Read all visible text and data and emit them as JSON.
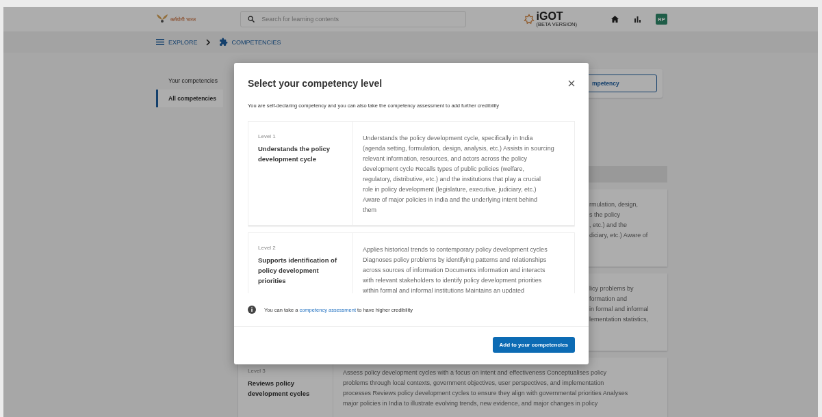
{
  "header": {
    "logo_text": "कर्मयोगी भारत",
    "search": {
      "placeholder": "Search for learning contents"
    },
    "brand": "iGOT",
    "brand_note": "(BETA VERSION)",
    "avatar": "RP"
  },
  "breadcrumb": [
    {
      "label": "EXPLORE",
      "kind": "menu"
    },
    {
      "label": "COMPETENCIES",
      "kind": "puzzle"
    }
  ],
  "sidebar": {
    "items": [
      {
        "label": "Your competencies",
        "selected": false
      },
      {
        "label": "All competencies",
        "selected": true
      }
    ]
  },
  "background": {
    "action_button": "mpetency",
    "cards": [
      {
        "lines": [
          "rmulation, design,",
          "s the policy",
          ", etc.) and the",
          "diciary, etc.) Aware of"
        ]
      },
      {
        "lines": [
          "licy problems by",
          "formation and",
          "in formal and informal",
          "lementation statistics,"
        ]
      },
      {
        "level": "Level 3",
        "title": "Reviews policy development cycles",
        "lines": [
          "Assess policy development cycles with a focus on intent and effectiveness Conceptualises policy",
          "problems through local contexts, government objectives, user perspectives, and implementation",
          "processes Reviews policy development cycles to ensure they align with governmental priorities Analyses",
          "major policies in India to illustrate evolving trends, new evidence, and major changes in policy"
        ]
      }
    ]
  },
  "dialog": {
    "title": "Select your competency level",
    "subtitle": "You are self-declaring competency and you can also take the competency assessment to add further credibility",
    "levels": [
      {
        "level": "Level 1",
        "title": "Understands the policy development cycle",
        "lines": [
          "Understands the policy development cycle, specifically in India",
          "(agenda setting, formulation, design, analysis, etc.) Assists in sourcing",
          "relevant information, resources, and actors across the policy",
          "development cycle Recalls types of public policies (welfare,",
          "regulatory, distributive, etc.) and the institutions that play a crucial",
          "role in policy development (legislature, executive, judiciary, etc.)",
          "Aware of major policies in India and the underlying intent behind",
          "them"
        ]
      },
      {
        "level": "Level 2",
        "title": "Supports identification of policy development priorities",
        "lines": [
          "Applies historical trends to contemporary policy development cycles",
          "Diagnoses policy problems by identifying patterns and relationships",
          "across sources of information Documents information and interacts",
          "with relevant stakeholders to identify policy development priorities",
          "within formal and informal institutions Maintains an updated"
        ]
      }
    ],
    "info": {
      "before": "You can take a",
      "link": "competency assessment",
      "after": "to have higher credibility"
    },
    "button": "Add to your competencies"
  }
}
